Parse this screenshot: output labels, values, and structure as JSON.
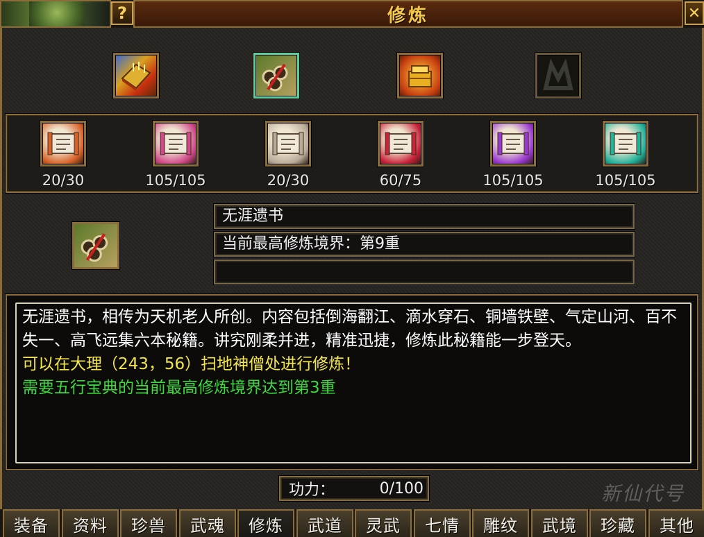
{
  "window": {
    "title": "修炼",
    "help_label": "?",
    "close_label": "✕"
  },
  "top_items": [
    {
      "icon": "golden-book-icon",
      "selected": false
    },
    {
      "icon": "scroll-bundle-icon",
      "selected": true
    },
    {
      "icon": "golden-treasure-icon",
      "selected": false
    },
    {
      "icon": "empty-slot-icon",
      "selected": false
    }
  ],
  "scrolls": [
    {
      "icon": "red-scroll-icon",
      "count": "20/30",
      "color": "#d8632a"
    },
    {
      "icon": "pink-scroll-icon",
      "count": "105/105",
      "color": "#d04a8a"
    },
    {
      "icon": "white-scroll-icon",
      "count": "20/30",
      "color": "#b8aa98"
    },
    {
      "icon": "crimson-scroll-icon",
      "count": "60/75",
      "color": "#c8243a"
    },
    {
      "icon": "purple-scroll-icon",
      "count": "105/105",
      "color": "#9a3ad0"
    },
    {
      "icon": "teal-scroll-icon",
      "count": "105/105",
      "color": "#22b29a"
    }
  ],
  "detail": {
    "name": "无涯遗书",
    "realm": "当前最高修炼境界：第9重",
    "extra": ""
  },
  "description": {
    "text": "无涯遗书，相传为天机老人所创。内容包括倒海翻江、滴水穿石、铜墙铁壁、气定山河、百不失一、高飞远集六本秘籍。讲究刚柔并进，精准迅捷，修炼此秘籍能一步登天。",
    "location": "可以在大理（243，56）扫地神僧处进行修炼！",
    "requirement": "需要五行宝典的当前最高修炼境界达到第3重",
    "colors": {
      "text": "#ffffff",
      "location": "#f2e64a",
      "requirement": "#3ed83e"
    }
  },
  "power": {
    "label": "功力：",
    "value": "0/100"
  },
  "tabs": [
    "装备",
    "资料",
    "珍兽",
    "武魂",
    "修炼",
    "武道",
    "灵武",
    "七情",
    "雕纹",
    "武境",
    "珍藏",
    "其他"
  ],
  "active_tab": "修炼",
  "watermark": "新仙代号"
}
